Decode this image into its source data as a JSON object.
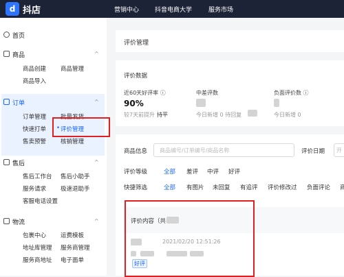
{
  "app": {
    "logo_glyph": "d",
    "name": "抖店"
  },
  "topnav": [
    "营销中心",
    "抖音电商大学",
    "服务市场"
  ],
  "sidebar": {
    "home": "首页",
    "goods": {
      "title": "商品",
      "items": [
        "商品创建",
        "商品管理",
        "商品导入"
      ]
    },
    "order": {
      "title": "订单",
      "items": [
        "订单管理",
        "批量发货",
        "快速打单",
        "评价管理",
        "售卖预警",
        "核销管理"
      ]
    },
    "aftersale": {
      "title": "售后",
      "items": [
        "售后工作台",
        "售后小助手",
        "服务请求",
        "极速退助手",
        "客服电话设置"
      ]
    },
    "logistics": {
      "title": "物流",
      "items": [
        "包裹中心",
        "运费模板",
        "地址库管理",
        "服务商管理",
        "服务商地址",
        "电子面单"
      ]
    }
  },
  "page": {
    "title": "评价管理"
  },
  "stats": {
    "section_title": "评价数据",
    "good_rate_label": "近60天好评率 ⓘ",
    "good_rate_value": "90%",
    "good_rate_compare_prefix": "较7天前提升",
    "good_rate_compare_value": "持平",
    "mid_label": "中差评数",
    "mid_sub": "今日新增 0   待回复",
    "neg_label": "负面评价数 ⓘ",
    "neg_sub": "今日新增 0"
  },
  "filters": {
    "goods_info_label": "商品信息",
    "goods_info_placeholder": "商品编号/订单编号/商品名称",
    "date_label": "评价日期",
    "date_value": "开",
    "level_label": "评价等级",
    "levels": [
      "全部",
      "差评",
      "中评",
      "好评"
    ],
    "quick_label": "快捷筛选",
    "quick": [
      "全部",
      "有图片",
      "未回复",
      "有追评",
      "评价修改过",
      "负面评论",
      "商"
    ]
  },
  "list": {
    "header": "评价内容（共   条）",
    "time": "2021/02/20 12:51:26",
    "tag": "好评"
  },
  "colors": {
    "accent": "#1966ff",
    "highlight": "#e02020",
    "topbar": "#1d2337"
  }
}
